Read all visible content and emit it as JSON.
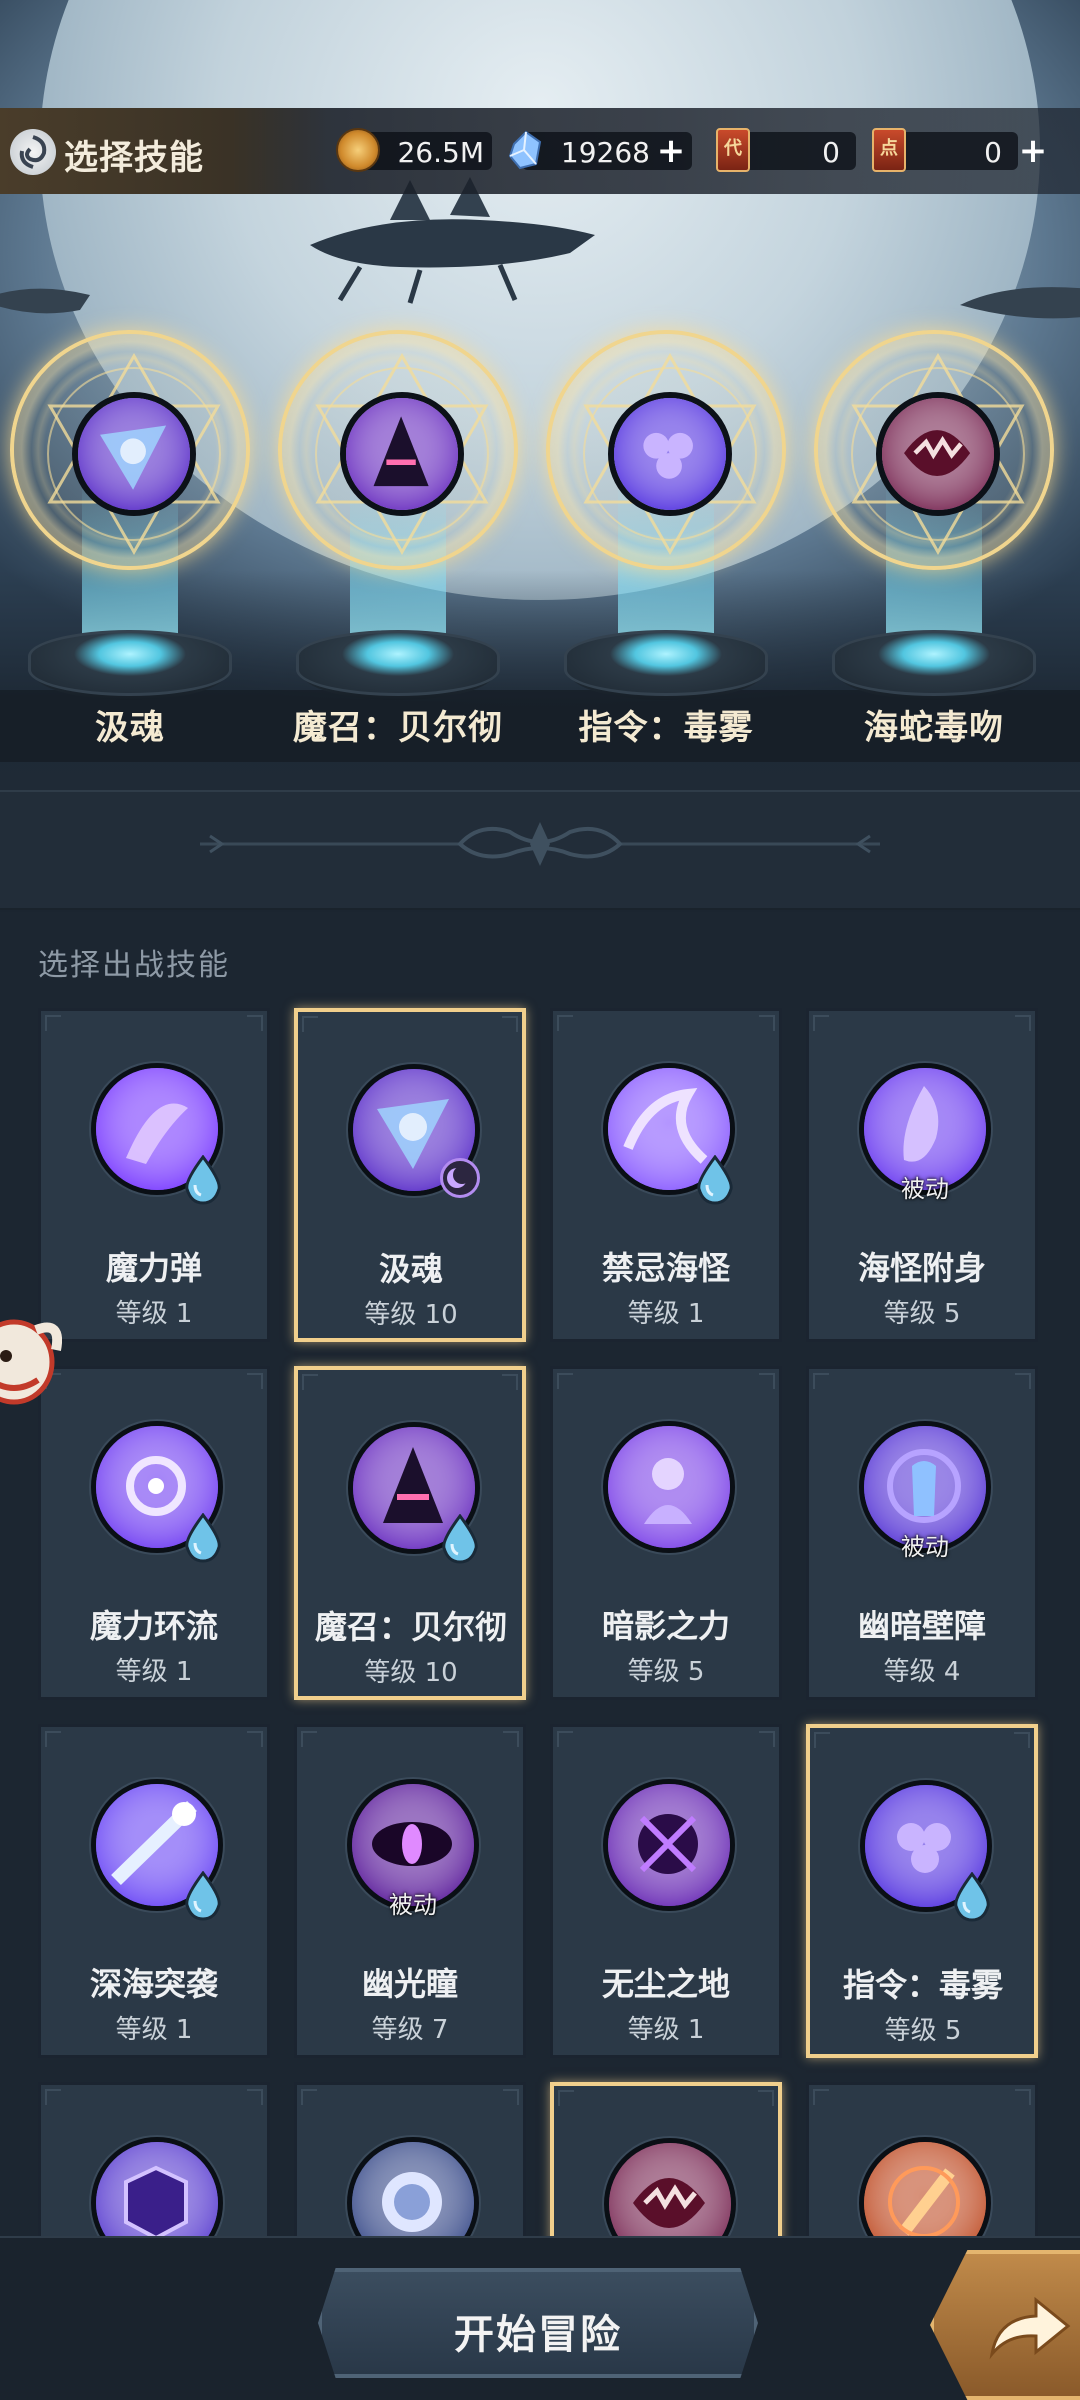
{
  "header": {
    "title": "选择技能",
    "resources": [
      {
        "icon": "gold-coin-icon",
        "value": "26.5M",
        "has_plus": false
      },
      {
        "icon": "crystal-gem-icon",
        "value": "19268",
        "has_plus": true
      },
      {
        "icon": "ticket-card-icon",
        "value": "0",
        "has_plus": false
      },
      {
        "icon": "point-card-icon",
        "value": "0",
        "has_plus": true
      }
    ]
  },
  "equipped": {
    "slots": [
      {
        "name": "汲魂",
        "icon": "soul-drain-icon"
      },
      {
        "name": "魔召：贝尔彻",
        "icon": "summon-beast-icon"
      },
      {
        "name": "指令：毒雾",
        "icon": "poison-mist-icon"
      },
      {
        "name": "海蛇毒吻",
        "icon": "sea-serpent-bite-icon"
      }
    ]
  },
  "panel": {
    "title": "选择出战技能",
    "passive_label": "被动",
    "skills": [
      {
        "name": "魔力弹",
        "level": "等级 1",
        "selected": false,
        "passive": false,
        "badge": "drop",
        "color": "#7a3cff"
      },
      {
        "name": "汲魂",
        "level": "等级 10",
        "selected": true,
        "passive": false,
        "badge": "moon",
        "color": "#5b2fc9"
      },
      {
        "name": "禁忌海怪",
        "level": "等级 1",
        "selected": false,
        "passive": false,
        "badge": "drop",
        "color": "#8a5cff"
      },
      {
        "name": "海怪附身",
        "level": "等级 5",
        "selected": false,
        "passive": true,
        "badge": "none",
        "color": "#6c3df0"
      },
      {
        "name": "魔力环流",
        "level": "等级 1",
        "selected": false,
        "passive": false,
        "badge": "drop",
        "color": "#7240f2"
      },
      {
        "name": "魔召：贝尔彻",
        "level": "等级 10",
        "selected": true,
        "passive": false,
        "badge": "drop",
        "color": "#6a2fc0"
      },
      {
        "name": "暗影之力",
        "level": "等级 5",
        "selected": false,
        "passive": false,
        "badge": "none",
        "color": "#7d44e8"
      },
      {
        "name": "幽暗壁障",
        "level": "等级 4",
        "selected": false,
        "passive": true,
        "badge": "none",
        "color": "#5a3ad6"
      },
      {
        "name": "深海突袭",
        "level": "等级 1",
        "selected": false,
        "passive": false,
        "badge": "drop",
        "color": "#6b48f5"
      },
      {
        "name": "幽光瞳",
        "level": "等级 7",
        "selected": false,
        "passive": true,
        "badge": "none",
        "color": "#5d1f9c"
      },
      {
        "name": "无尘之地",
        "level": "等级 1",
        "selected": false,
        "passive": false,
        "badge": "none",
        "color": "#6a2cb5"
      },
      {
        "name": "指令：毒雾",
        "level": "等级 5",
        "selected": true,
        "passive": false,
        "badge": "drop",
        "color": "#5636e0"
      },
      {
        "name": "",
        "level": "",
        "selected": false,
        "passive": false,
        "badge": "none",
        "color": "#5b3fd0"
      },
      {
        "name": "",
        "level": "",
        "selected": false,
        "passive": false,
        "badge": "none",
        "color": "#3a4c8a"
      },
      {
        "name": "",
        "level": "",
        "selected": true,
        "passive": false,
        "badge": "none",
        "color": "#7a2a55"
      },
      {
        "name": "",
        "level": "",
        "selected": false,
        "passive": false,
        "badge": "none",
        "color": "#c0502a"
      }
    ]
  },
  "footer": {
    "start_label": "开始冒险",
    "share_icon": "share-arrow-icon"
  },
  "colors": {
    "accent_gold": "#f1cf8c",
    "card_bg": "#2b3947",
    "panel_bg": "#1c2631",
    "water_drop": "#6fc3e8"
  }
}
